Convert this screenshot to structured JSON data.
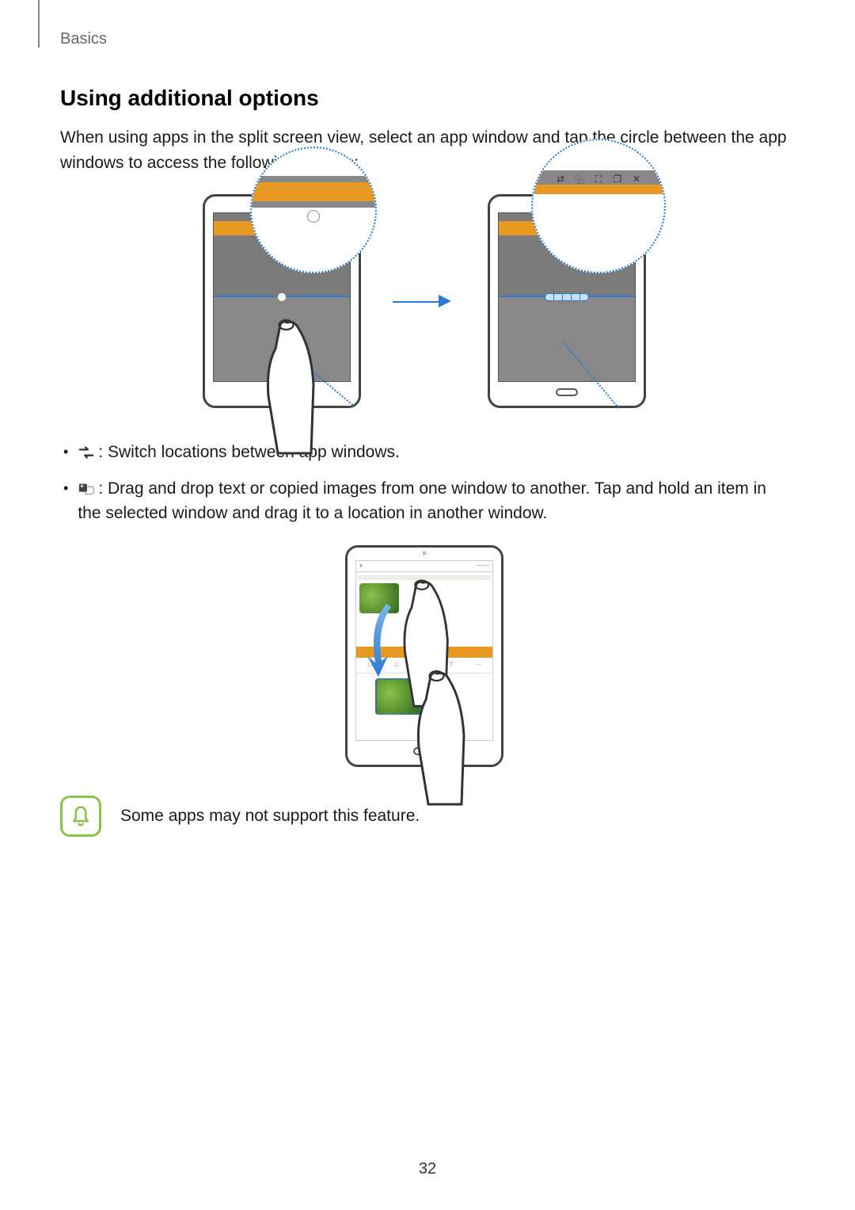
{
  "breadcrumb": "Basics",
  "heading": "Using additional options",
  "intro": "When using apps in the split screen view, select an app window and tap the circle between the app windows to access the following options:",
  "bullets": {
    "switch": ": Switch locations between app windows.",
    "drag": ": Drag and drop text or copied images from one window to another. Tap and hold an item in the selected window and drag it to a location in another window."
  },
  "note": "Some apps may not support this feature.",
  "page_number": "32",
  "icons": {
    "switch_name": "switch-windows-icon",
    "drag_name": "drag-drop-icon",
    "note_name": "notification-bell-icon",
    "toolbar": {
      "swap": "⇄",
      "copy": "⿻",
      "maximize": "⛶",
      "window": "❐",
      "close": "✕"
    }
  }
}
